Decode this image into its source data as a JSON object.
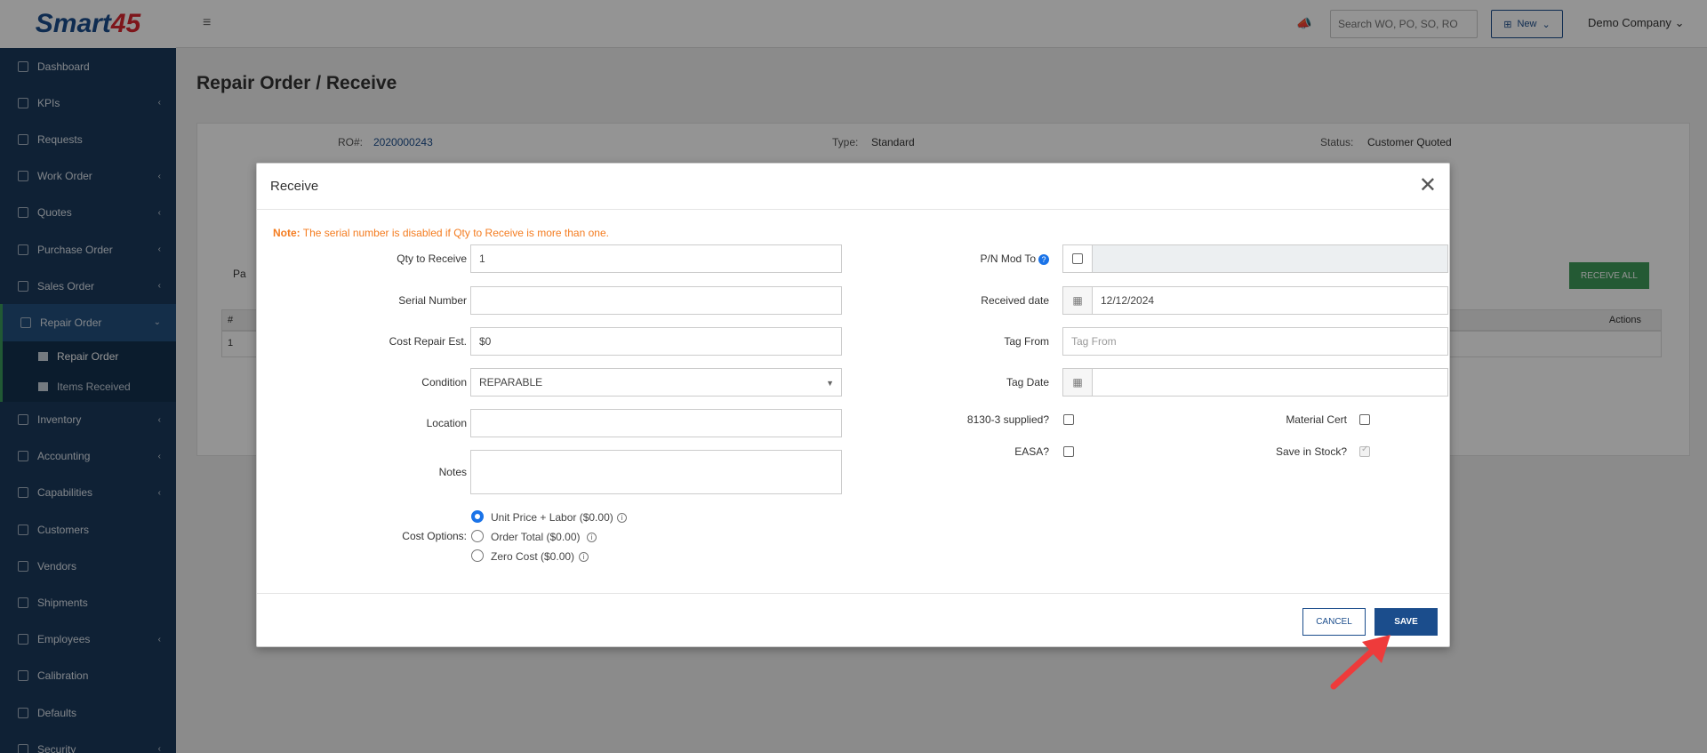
{
  "brand": {
    "logo_text": "Smart",
    "logo_mark": "45"
  },
  "sidebar": {
    "items": [
      {
        "label": "Dashboard",
        "icon": "chart-icon"
      },
      {
        "label": "KPIs",
        "icon": "kpi-icon",
        "chev": "‹"
      },
      {
        "label": "Requests",
        "icon": "document-icon"
      },
      {
        "label": "Work Order",
        "icon": "list-icon",
        "chev": "‹"
      },
      {
        "label": "Quotes",
        "icon": "quote-icon",
        "chev": "‹"
      },
      {
        "label": "Purchase Order",
        "icon": "cart-icon",
        "chev": "‹"
      },
      {
        "label": "Sales Order",
        "icon": "sales-icon",
        "chev": "‹"
      },
      {
        "label": "Repair Order",
        "icon": "repair-icon",
        "chev": "⌄"
      },
      {
        "label": "Inventory",
        "icon": "inventory-icon",
        "chev": "‹"
      },
      {
        "label": "Accounting",
        "icon": "accounting-icon",
        "chev": "‹"
      },
      {
        "label": "Capabilities",
        "icon": "capabilities-icon",
        "chev": "‹"
      },
      {
        "label": "Customers",
        "icon": "customers-icon"
      },
      {
        "label": "Vendors",
        "icon": "vendors-icon"
      },
      {
        "label": "Shipments",
        "icon": "shipments-icon"
      },
      {
        "label": "Employees",
        "icon": "employees-icon",
        "chev": "‹"
      },
      {
        "label": "Calibration",
        "icon": "calibration-icon"
      },
      {
        "label": "Defaults",
        "icon": "defaults-icon"
      },
      {
        "label": "Security",
        "icon": "security-icon",
        "chev": "‹"
      }
    ],
    "sub_items": [
      "Repair Order",
      "Items Received"
    ]
  },
  "topbar": {
    "menu_icon": "≡",
    "search_placeholder": "Search WO, PO, SO, RO",
    "new_label": "New",
    "company": "Demo Company"
  },
  "page": {
    "title": "Repair Order / Receive",
    "ro_label": "RO#:",
    "ro_value": "2020000243",
    "type_label": "Type:",
    "type_value": "Standard",
    "status_label": "Status:",
    "status_value": "Customer Quoted",
    "receive_all": "RECEIVE ALL",
    "tab_partial": "Pa",
    "table_hash": "#",
    "table_actions": "Actions",
    "row_num": "1"
  },
  "modal": {
    "title": "Receive",
    "note_bold": "Note:",
    "note_text": "The serial number is disabled if Qty to Receive is more than one.",
    "qty_label": "Qty to Receive",
    "qty_value": "1",
    "serial_label": "Serial Number",
    "serial_value": "",
    "cost_label": "Cost Repair Est.",
    "cost_value": "$0",
    "condition_label": "Condition",
    "condition_value": "REPARABLE",
    "location_label": "Location",
    "location_value": "",
    "notes_label": "Notes",
    "notes_value": "",
    "cost_options_label": "Cost Options:",
    "cost_options": [
      "Unit Price + Labor ($0.00)",
      "Order Total ($0.00)",
      "Zero Cost ($0.00)"
    ],
    "selected_cost_option": 0,
    "pn_mod_label": "P/N Mod To",
    "received_label": "Received date",
    "received_value": "12/12/2024",
    "tag_from_label": "Tag From",
    "tag_from_placeholder": "Tag From",
    "tag_date_label": "Tag Date",
    "tag_date_value": "",
    "c8130_label": "8130-3 supplied?",
    "material_cert_label": "Material Cert",
    "easa_label": "EASA?",
    "save_stock_label": "Save in Stock?",
    "cancel": "CANCEL",
    "save": "SAVE"
  },
  "colors": {
    "sidebar": "#1b3a5c",
    "primary": "#1b4d8c",
    "note": "#f47c20",
    "success": "#3e9c5a",
    "arrow": "#ee3b3b"
  }
}
